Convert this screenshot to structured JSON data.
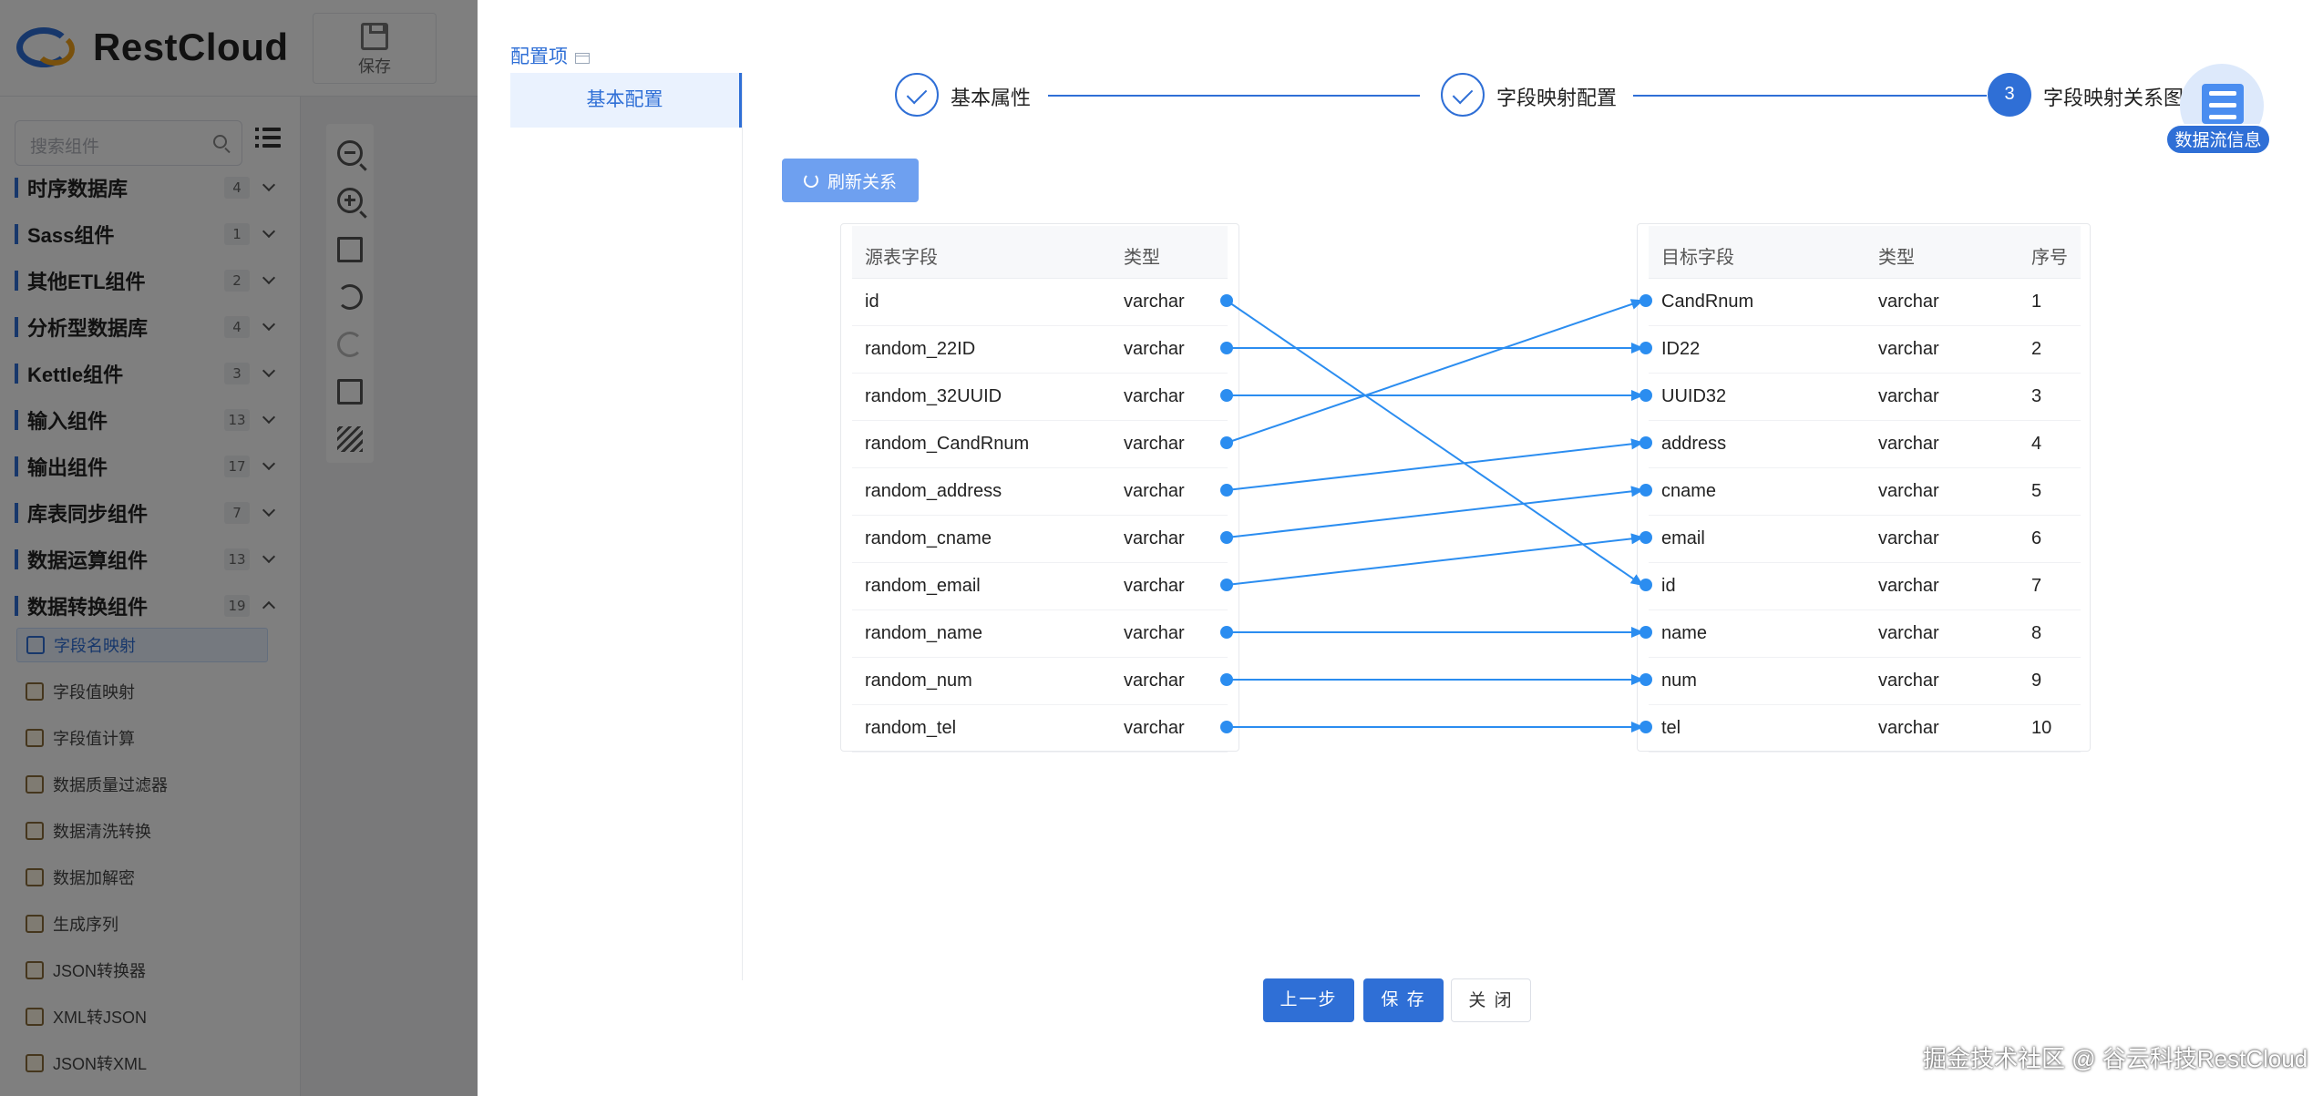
{
  "app": {
    "logo_text": "RestCloud",
    "save_tool_label": "保存"
  },
  "sidebar": {
    "search_placeholder": "搜索组件",
    "categories": [
      {
        "label": "时序数据库",
        "count": "4"
      },
      {
        "label": "Sass组件",
        "count": "1"
      },
      {
        "label": "其他ETL组件",
        "count": "2"
      },
      {
        "label": "分析型数据库",
        "count": "4"
      },
      {
        "label": "Kettle组件",
        "count": "3"
      },
      {
        "label": "输入组件",
        "count": "13"
      },
      {
        "label": "输出组件",
        "count": "17"
      },
      {
        "label": "库表同步组件",
        "count": "7"
      },
      {
        "label": "数据运算组件",
        "count": "13"
      },
      {
        "label": "数据转换组件",
        "count": "19"
      }
    ],
    "components": [
      "字段名映射",
      "字段值映射",
      "字段值计算",
      "数据质量过滤器",
      "数据清洗转换",
      "数据加解密",
      "生成序列",
      "JSON转换器",
      "XML转JSON",
      "JSON转XML"
    ]
  },
  "drawer": {
    "config_title": "配置项",
    "config_tab": "基本配置",
    "steps": [
      {
        "label": "基本属性",
        "state": "done"
      },
      {
        "label": "字段映射配置",
        "state": "done"
      },
      {
        "label": "字段映射关系图",
        "state": "current",
        "number": "3"
      }
    ],
    "flow_badge": "数据流信息",
    "refresh_button": "刷新关系",
    "source": {
      "headers": [
        "源表字段",
        "类型"
      ],
      "rows": [
        [
          "id",
          "varchar"
        ],
        [
          "random_22ID",
          "varchar"
        ],
        [
          "random_32UUID",
          "varchar"
        ],
        [
          "random_CandRnum",
          "varchar"
        ],
        [
          "random_address",
          "varchar"
        ],
        [
          "random_cname",
          "varchar"
        ],
        [
          "random_email",
          "varchar"
        ],
        [
          "random_name",
          "varchar"
        ],
        [
          "random_num",
          "varchar"
        ],
        [
          "random_tel",
          "varchar"
        ]
      ]
    },
    "target": {
      "headers": [
        "目标字段",
        "类型",
        "序号"
      ],
      "rows": [
        [
          "CandRnum",
          "varchar",
          "1"
        ],
        [
          "ID22",
          "varchar",
          "2"
        ],
        [
          "UUID32",
          "varchar",
          "3"
        ],
        [
          "address",
          "varchar",
          "4"
        ],
        [
          "cname",
          "varchar",
          "5"
        ],
        [
          "email",
          "varchar",
          "6"
        ],
        [
          "id",
          "varchar",
          "7"
        ],
        [
          "name",
          "varchar",
          "8"
        ],
        [
          "num",
          "varchar",
          "9"
        ],
        [
          "tel",
          "varchar",
          "10"
        ]
      ]
    },
    "mappings": [
      {
        "source": "id",
        "target": "id"
      },
      {
        "source": "random_22ID",
        "target": "ID22"
      },
      {
        "source": "random_32UUID",
        "target": "UUID32"
      },
      {
        "source": "random_CandRnum",
        "target": "CandRnum"
      },
      {
        "source": "random_address",
        "target": "address"
      },
      {
        "source": "random_cname",
        "target": "cname"
      },
      {
        "source": "random_email",
        "target": "email"
      },
      {
        "source": "random_name",
        "target": "name"
      },
      {
        "source": "random_num",
        "target": "num"
      },
      {
        "source": "random_tel",
        "target": "tel"
      }
    ],
    "buttons": {
      "prev": "上一步",
      "save": "保 存",
      "close": "关 闭"
    },
    "line_color": "#2b8df0"
  },
  "watermark": "掘金技术社区 @ 谷云科技RestCloud"
}
